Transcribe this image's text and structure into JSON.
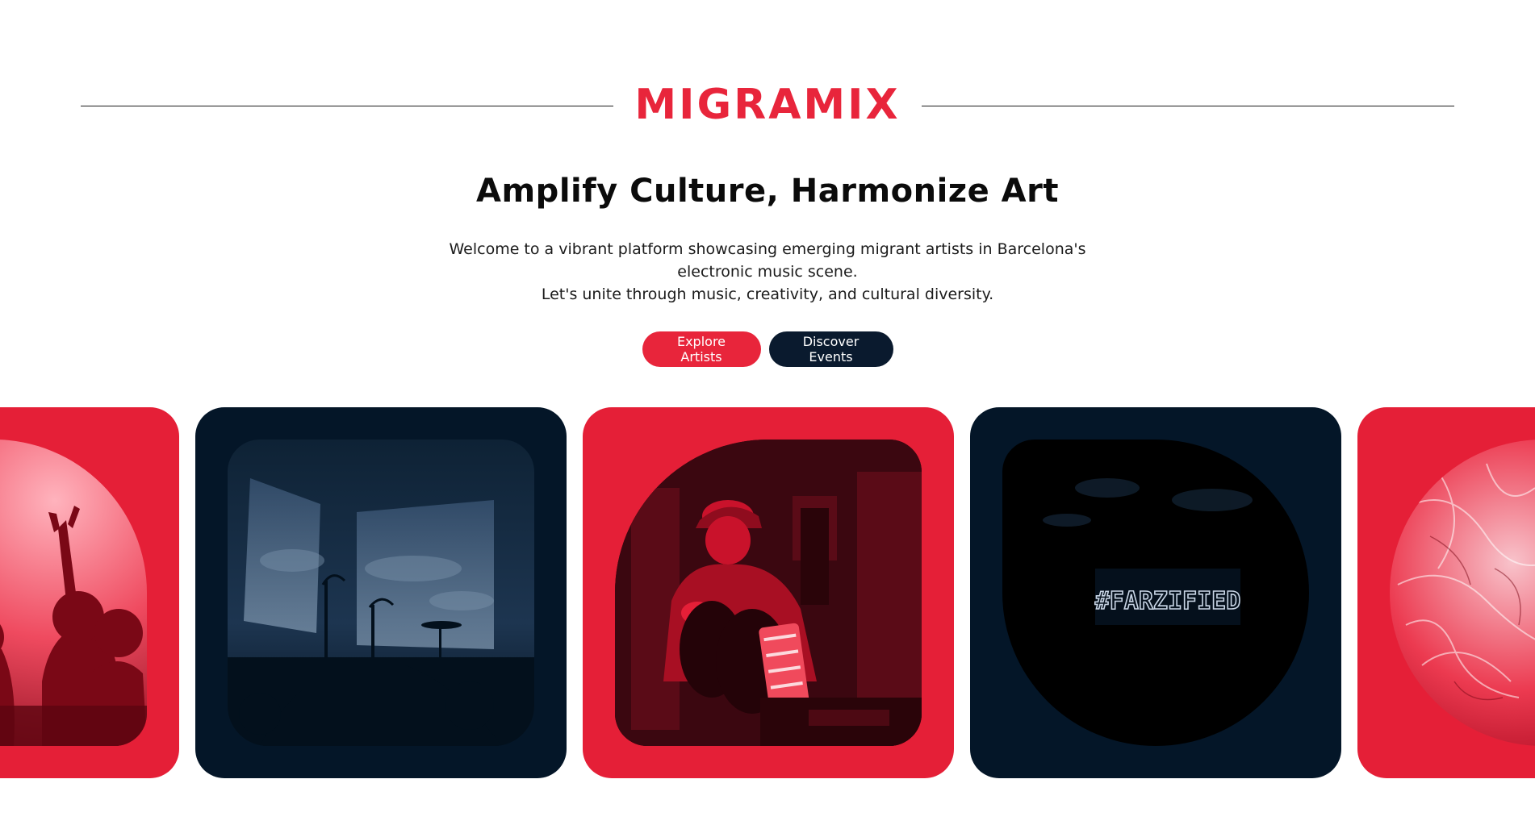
{
  "brand": {
    "name": "MIGRAMIX",
    "accent_color": "#e8253b",
    "dark_color": "#0a1a2e"
  },
  "hero": {
    "title": "Amplify Culture, Harmonize Art",
    "line1": "Welcome to a vibrant platform showcasing emerging migrant artists in Barcelona's",
    "line2": "electronic music scene.",
    "line3": "Let's unite through music, creativity, and cultural diversity."
  },
  "actions": {
    "explore_label": "Explore Artists",
    "discover_label": "Discover Events"
  },
  "gallery": {
    "cards": [
      {
        "theme": "red",
        "image": "crowd-hands-photo"
      },
      {
        "theme": "navy",
        "image": "stage-silhouette-photo"
      },
      {
        "theme": "red",
        "image": "dj-vinyl-photo"
      },
      {
        "theme": "navy",
        "image": "neon-sign-photo",
        "sign_text": "#FARZIFIED"
      },
      {
        "theme": "red",
        "image": "abstract-texture-photo"
      }
    ]
  }
}
